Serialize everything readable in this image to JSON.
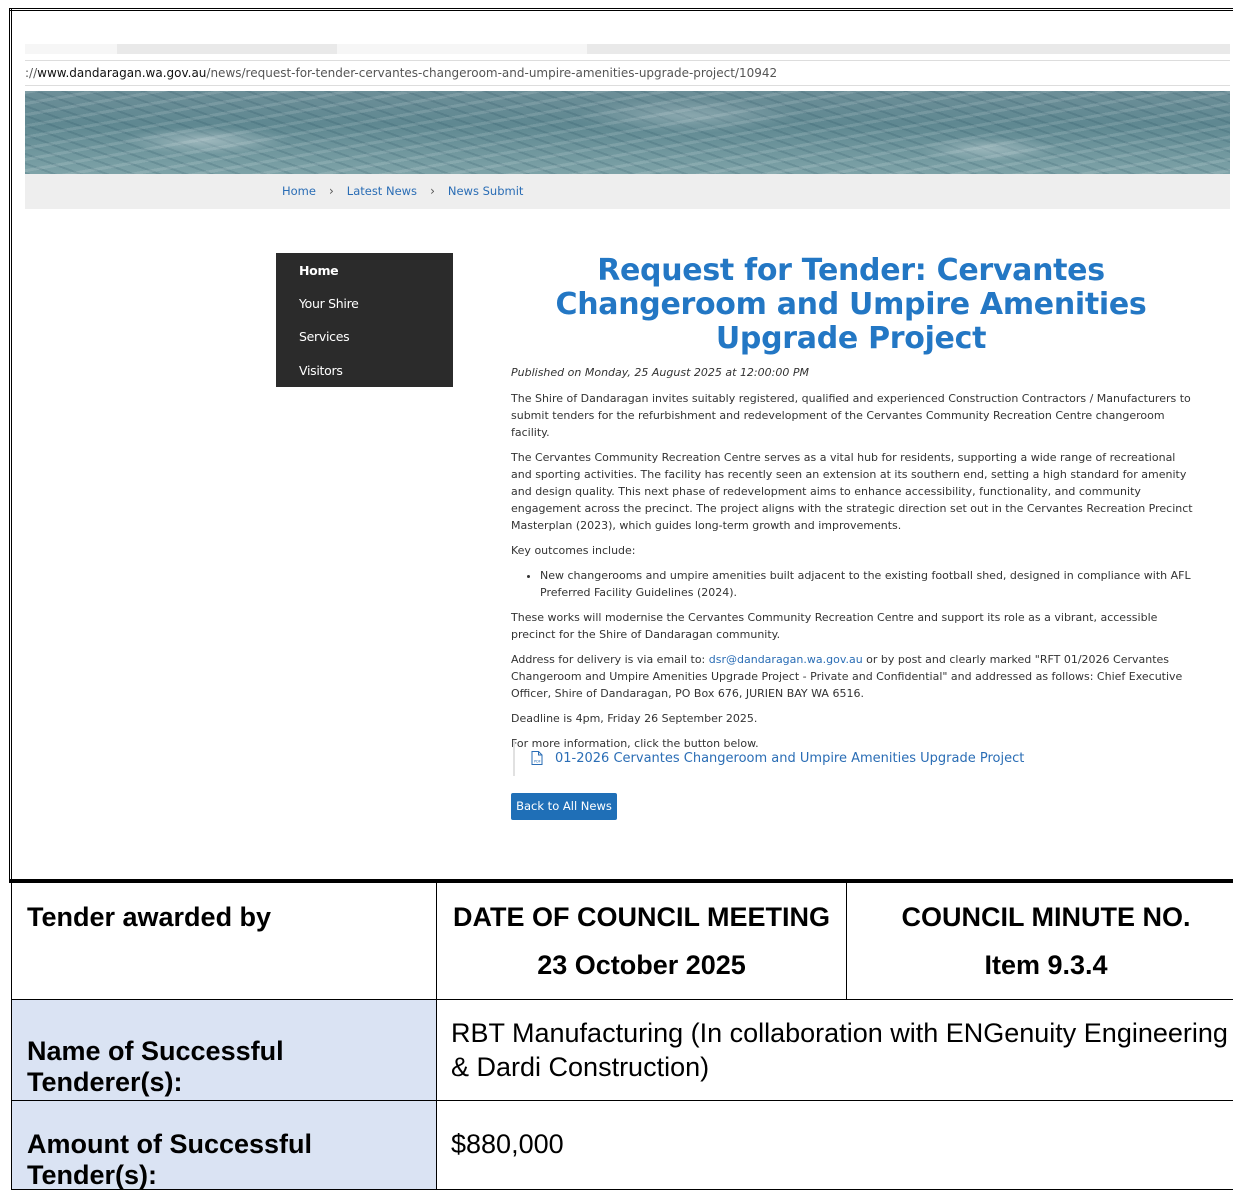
{
  "browser": {
    "url_prefix": "://",
    "url_host": "www.dandaragan.wa.gov.au",
    "url_path": "/news/request-for-tender-cervantes-changeroom-and-umpire-amenities-upgrade-project/10942"
  },
  "breadcrumb": {
    "home": "Home",
    "latest_news": "Latest News",
    "news_submit": "News Submit"
  },
  "sidenav": {
    "items": [
      "Home",
      "Your Shire",
      "Services",
      "Visitors"
    ]
  },
  "article": {
    "title": "Request for Tender: Cervantes Changeroom and Umpire Amenities Upgrade Project",
    "published": "Published on Monday, 25 August 2025 at 12:00:00 PM",
    "p1": "The Shire of Dandaragan invites suitably registered, qualified and experienced Construction Contractors / Manufacturers to submit tenders for the refurbishment and redevelopment of the Cervantes Community Recreation Centre changeroom facility.",
    "p2": "The Cervantes Community Recreation Centre serves as a vital hub for residents, supporting a wide range of recreational and sporting activities. The facility has recently seen an extension at its southern end, setting a high standard for amenity and design quality. This next phase of redevelopment aims to enhance accessibility, functionality, and community engagement across the precinct. The project aligns with the strategic direction set out in the Cervantes Recreation Precinct Masterplan (2023), which guides long-term growth and improvements.",
    "key_outcomes": "Key outcomes include:",
    "bullet1": "New changerooms and umpire amenities built adjacent to the existing football shed, designed in compliance with AFL Preferred Facility Guidelines (2024).",
    "p3": "These works will modernise the Cervantes Community Recreation Centre and support its role as a vibrant, accessible precinct for the Shire of Dandaragan community.",
    "address_before": "Address for delivery is via email to: ",
    "email": "dsr@dandaragan.wa.gov.au",
    "address_after": " or by post and clearly marked \"RFT 01/2026 Cervantes Changeroom and Umpire Amenities Upgrade Project - Private and Confidential\" and addressed as follows: Chief Executive Officer, Shire of Dandaragan, PO Box 676, JURIEN BAY WA 6516.",
    "deadline": "Deadline is 4pm, Friday 26 September 2025.",
    "more_info": "For more information, click the button below.",
    "download_label": "01-2026 Cervantes Changeroom and Umpire Amenities Upgrade Project",
    "back_button": "Back to All News"
  },
  "table": {
    "tender_awarded_by": "Tender awarded by",
    "date_header": "DATE OF COUNCIL MEETING",
    "date_value": "23 October 2025",
    "minute_header": "COUNCIL MINUTE NO.",
    "minute_value": "Item 9.3.4",
    "name_label": "Name of Successful Tenderer(s):",
    "name_value": "RBT Manufacturing (In collaboration with ENGenuity Engineering & Dardi Construction)",
    "amount_label": "Amount of Successful Tender(s):",
    "amount_value": "$880,000",
    "label_bg": "#dae3f3"
  }
}
